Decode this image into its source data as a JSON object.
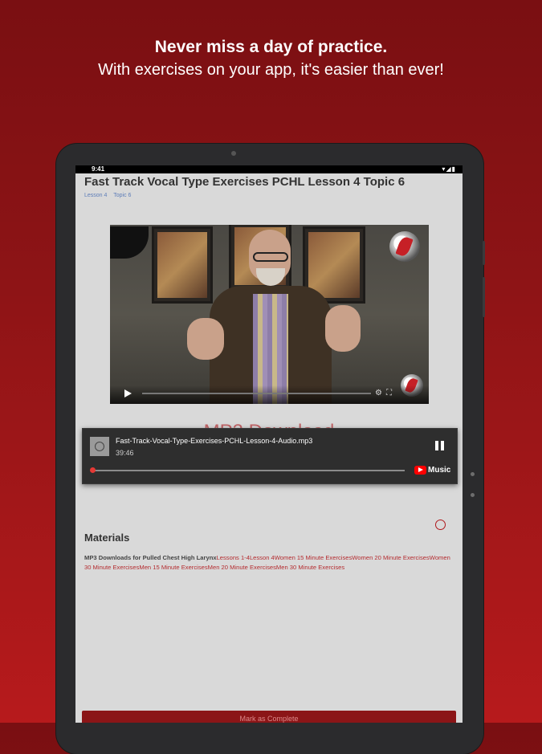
{
  "promo": {
    "headline": "Never miss a day of practice.",
    "subline": "With exercises on your app, it's easier than ever!"
  },
  "status_bar": {
    "time": "9:41",
    "icons": [
      "wifi-icon",
      "signal-icon",
      "battery-icon"
    ]
  },
  "page": {
    "title": "Fast Track Vocal Type Exercises PCHL Lesson 4 Topic 6",
    "breadcrumbs": [
      "Lesson 4",
      "Topic 6"
    ]
  },
  "video": {
    "icons": [
      "play-icon",
      "settings-icon",
      "fullscreen-icon"
    ]
  },
  "section": {
    "heading": "MP3 Download"
  },
  "player": {
    "track": "Fast-Track-Vocal-Type-Exercises-PCHL-Lesson-4-Audio.mp3",
    "duration": "39:46",
    "progress": 0.0,
    "brand": "Music"
  },
  "materials": {
    "heading": "Materials",
    "lead": "MP3 Downloads for Pulled Chest High Larynx",
    "links": [
      "Lessons 1-4",
      "Lesson 4",
      "Women 15 Minute Exercises",
      "Women 20 Minute Exercises",
      "Women 30 Minute Exercises",
      "Men 15 Minute Exercises",
      "Men 20 Minute Exercises",
      "Men 30 Minute Exercises"
    ]
  },
  "footer": {
    "complete_label": "Mark as Complete"
  },
  "colors": {
    "accent": "#b0181c",
    "background_top": "#7a0f12",
    "background_bottom": "#b71a1c"
  }
}
